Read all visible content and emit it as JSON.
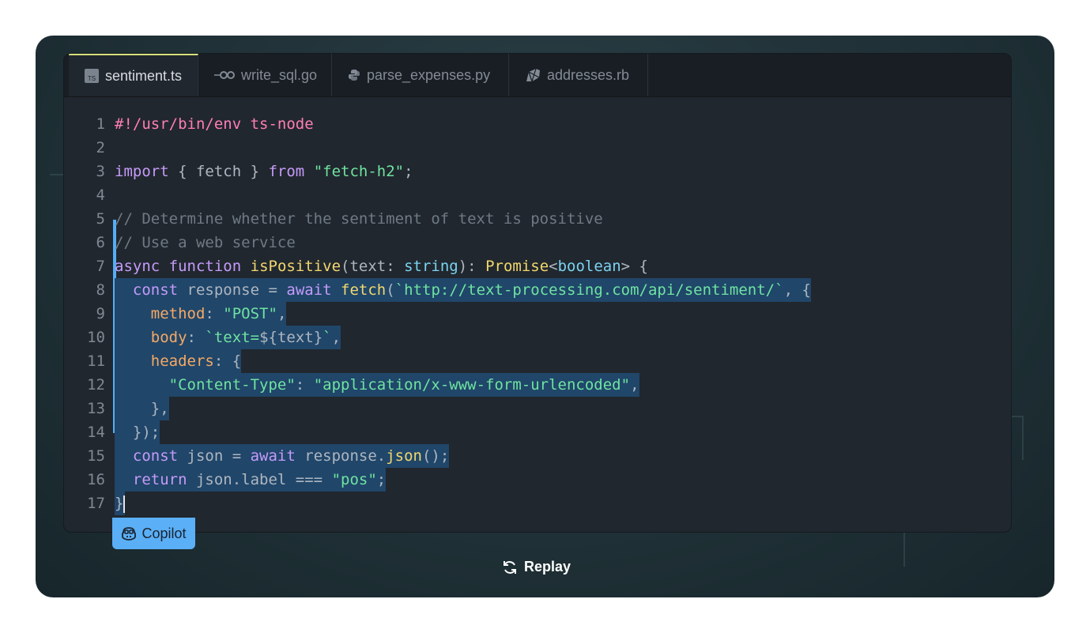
{
  "tabs": [
    {
      "label": "sentiment.ts",
      "icon": "typescript-icon"
    },
    {
      "label": "write_sql.go",
      "icon": "go-icon"
    },
    {
      "label": "parse_expenses.py",
      "icon": "python-icon"
    },
    {
      "label": "addresses.rb",
      "icon": "ruby-icon"
    }
  ],
  "ts_badge": "TS",
  "code": {
    "line_numbers": [
      "1",
      "2",
      "3",
      "4",
      "5",
      "6",
      "7",
      "8",
      "9",
      "10",
      "11",
      "12",
      "13",
      "14",
      "15",
      "16",
      "17"
    ],
    "l1": {
      "a": "#!/usr/bin/env ts-node"
    },
    "l3": {
      "a": "import",
      "b": " { fetch } ",
      "c": "from",
      "d": " ",
      "e": "\"fetch-h2\"",
      "f": ";"
    },
    "l5": {
      "a": "// Determine whether the sentiment of text is positive"
    },
    "l6": {
      "a": "// Use a web service"
    },
    "l7": {
      "a": "async",
      "b": " ",
      "c": "function",
      "d": " ",
      "e": "isPositive",
      "f": "(text: ",
      "g": "string",
      "h": "): ",
      "i": "Promise",
      "j": "<",
      "k": "boolean",
      "l": "> {"
    },
    "l8": {
      "a": "  ",
      "b": "const",
      "c": " response = ",
      "d": "await",
      "e": " ",
      "f": "fetch",
      "g": "(",
      "h": "`http://text-processing.com/api/sentiment/`",
      "i": ", {"
    },
    "l9": {
      "a": "    ",
      "b": "method",
      "c": ": ",
      "d": "\"POST\"",
      "e": ","
    },
    "l10": {
      "a": "    ",
      "b": "body",
      "c": ": ",
      "d": "`text=",
      "e": "${text}",
      "f": "`",
      "g": ","
    },
    "l11": {
      "a": "    ",
      "b": "headers",
      "c": ": {"
    },
    "l12": {
      "a": "      ",
      "b": "\"Content-Type\"",
      "c": ": ",
      "d": "\"application/x-www-form-urlencoded\"",
      "e": ","
    },
    "l13": {
      "a": "    },"
    },
    "l14": {
      "a": "  });"
    },
    "l15": {
      "a": "  ",
      "b": "const",
      "c": " json = ",
      "d": "await",
      "e": " response.",
      "f": "json",
      "g": "();"
    },
    "l16": {
      "a": "  ",
      "b": "return",
      "c": " json.label === ",
      "d": "\"pos\"",
      "e": ";"
    },
    "l17": {
      "a": "}"
    }
  },
  "copilot": {
    "label": "Copilot",
    "icon": "copilot-icon"
  },
  "replay": {
    "label": "Replay",
    "icon": "replay-icon"
  },
  "colors": {
    "accent": "#5aaff6",
    "selection": "#20466a",
    "active_tab_border": "#d8e07e"
  }
}
